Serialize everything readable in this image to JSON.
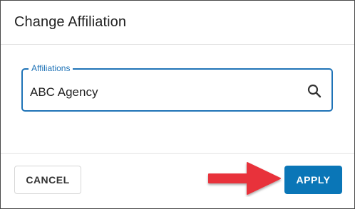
{
  "dialog": {
    "title": "Change Affiliation"
  },
  "affiliations_field": {
    "label": "Affiliations",
    "value": "ABC Agency",
    "icon": "search-icon"
  },
  "actions": {
    "cancel_label": "CANCEL",
    "apply_label": "APPLY"
  },
  "colors": {
    "accent": "#1f73b7",
    "apply_button": "#0a76b7",
    "annotation_arrow": "#e8333a"
  }
}
